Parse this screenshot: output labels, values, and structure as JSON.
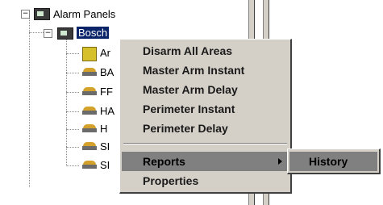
{
  "tree": {
    "root_label": "Alarm Panels",
    "panel_label": "Bosch",
    "children": [
      {
        "label": "Ar",
        "icon": "area-icon"
      },
      {
        "label": "BA",
        "icon": "detector-icon"
      },
      {
        "label": "FF",
        "icon": "detector-icon"
      },
      {
        "label": "HA",
        "icon": "detector-icon"
      },
      {
        "label": "H",
        "icon": "detector-icon"
      },
      {
        "label": "SI",
        "icon": "detector-icon"
      },
      {
        "label": "SI",
        "icon": "detector-icon"
      }
    ]
  },
  "context_menu": {
    "items": [
      {
        "label": "Disarm All Areas"
      },
      {
        "label": "Master Arm Instant"
      },
      {
        "label": "Master Arm Delay"
      },
      {
        "label": "Perimeter Instant"
      },
      {
        "label": "Perimeter Delay"
      },
      {
        "label": "Reports"
      },
      {
        "label": "Properties"
      }
    ]
  },
  "submenu": {
    "items": [
      {
        "label": "History"
      }
    ]
  },
  "colors": {
    "selection": "#0a246a",
    "menu_bg": "#d4d0c8",
    "highlight": "#808080"
  }
}
